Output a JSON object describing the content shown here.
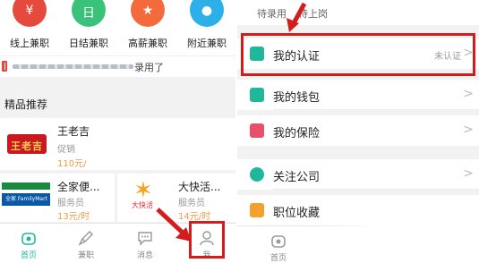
{
  "left": {
    "categories": [
      {
        "label": "线上兼职",
        "icon": "money-icon",
        "color": "#e64a3c",
        "glyph": "¥"
      },
      {
        "label": "日结兼职",
        "icon": "clock-icon",
        "color": "#3ac27a",
        "glyph": "日"
      },
      {
        "label": "高薪兼职",
        "icon": "star-icon",
        "color": "#f36b3d",
        "glyph": "★"
      },
      {
        "label": "附近兼职",
        "icon": "location-icon",
        "color": "#2db0e8",
        "glyph": "●"
      }
    ],
    "ticker_text": "录用了",
    "section_title": "精品推荐",
    "cards": [
      {
        "name": "王老吉",
        "role": "促销",
        "pay": "110元/",
        "logo_text": "王老吉"
      },
      {
        "name": "全家便...",
        "role": "服务员",
        "pay": "13元/时",
        "logo_text": "全家 FamilyMart"
      },
      {
        "name": "大快活...",
        "role": "服务员",
        "pay": "14元/时",
        "logo_text": "大快活"
      }
    ],
    "tabs": [
      {
        "label": "首页",
        "icon": "home-icon",
        "active": true
      },
      {
        "label": "兼职",
        "icon": "rocket-icon",
        "active": false
      },
      {
        "label": "消息",
        "icon": "message-icon",
        "active": false
      },
      {
        "label": "我",
        "icon": "person-icon",
        "active": false
      }
    ]
  },
  "right": {
    "order_tabs": [
      "待录用",
      "待上岗"
    ],
    "rows": [
      {
        "label": "我的认证",
        "value": "未认证",
        "icon": "certificate-icon",
        "color": "#1fb89a"
      },
      {
        "label": "我的钱包",
        "value": "",
        "icon": "wallet-icon",
        "color": "#1fb89a"
      },
      {
        "label": "我的保险",
        "value": "",
        "icon": "heart-icon",
        "color": "#e8506a"
      },
      {
        "label": "关注公司",
        "value": "",
        "icon": "eye-icon",
        "color": "#1fb89a"
      },
      {
        "label": "职位收藏",
        "value": "",
        "icon": "star-icon",
        "color": "#f3a02d"
      }
    ],
    "bottom_tab_label": "首页"
  },
  "colors": {
    "highlight": "#d31d1d",
    "accent": "#1fb89a",
    "salary": "#f09a46"
  }
}
